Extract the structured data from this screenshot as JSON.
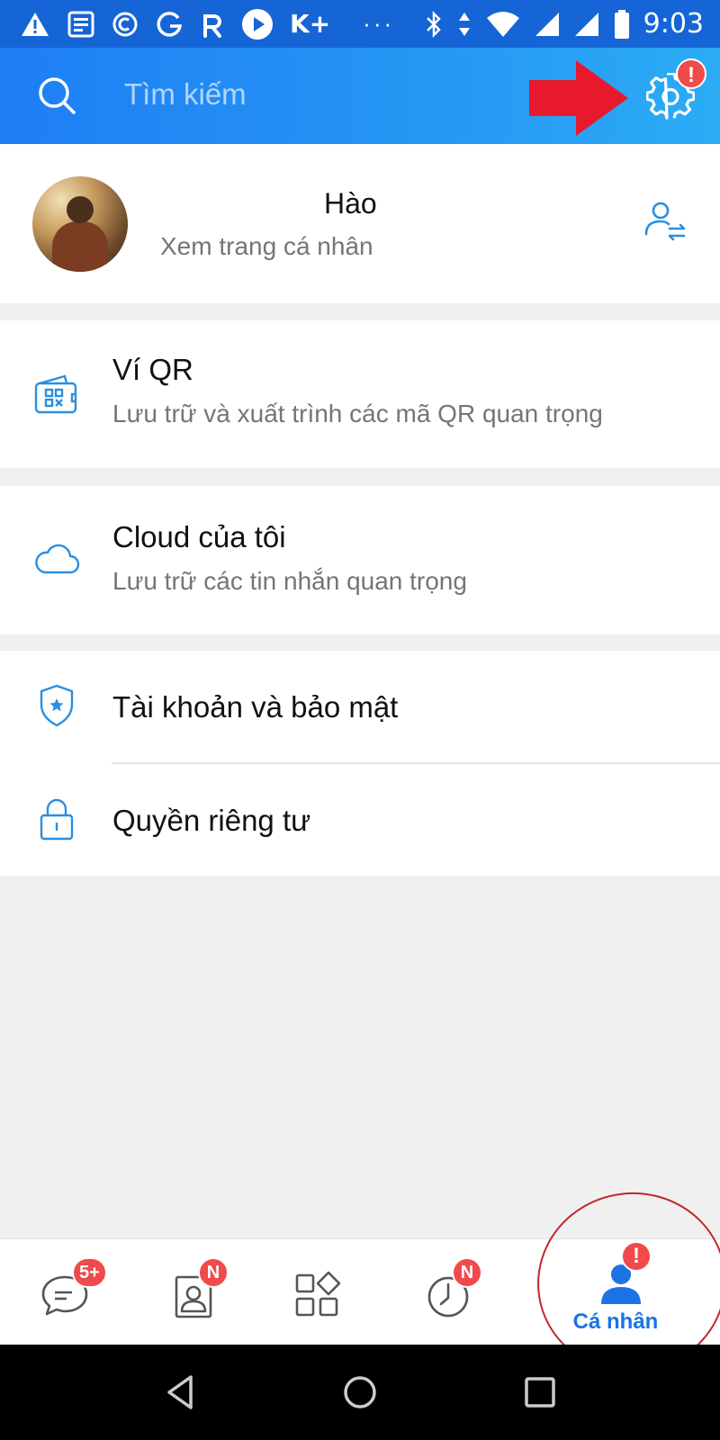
{
  "status_bar": {
    "icons": [
      "warning-icon",
      "news-icon",
      "copyright-c-icon",
      "g-icon",
      "r-icon",
      "play-icon",
      "kplus-icon"
    ],
    "kplus_label": "K+",
    "dots": "···",
    "right_icons": [
      "bluetooth-icon",
      "data-arrows-icon",
      "wifi-icon",
      "signal-icon",
      "signal-icon",
      "battery-icon"
    ],
    "time": "9:03"
  },
  "header": {
    "search_placeholder": "Tìm kiếm",
    "settings_badge": "!",
    "annotation_arrow_color": "#e8192c"
  },
  "profile": {
    "name": "Hào",
    "subtitle": "Xem trang cá nhân"
  },
  "menu": {
    "qr": {
      "title": "Ví QR",
      "subtitle": "Lưu trữ và xuất trình các mã QR quan trọng"
    },
    "cloud": {
      "title": "Cloud của tôi",
      "subtitle": "Lưu trữ các tin nhắn quan trọng"
    },
    "account": {
      "title": "Tài khoản và bảo mật"
    },
    "privacy": {
      "title": "Quyền riêng tư"
    }
  },
  "bottom_nav": {
    "messages_badge": "5+",
    "contacts_badge": "N",
    "timeline_badge": "N",
    "profile_badge": "!",
    "profile_label": "Cá nhân"
  },
  "colors": {
    "accent": "#1b73e6",
    "icon_blue": "#2a8fe0",
    "badge_red": "#f04a4a",
    "annotation_red": "#c1272d"
  }
}
